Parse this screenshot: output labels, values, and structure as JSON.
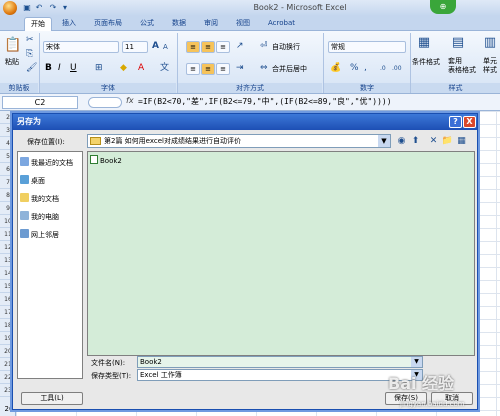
{
  "window": {
    "title": "Book2 - Microsoft Excel"
  },
  "ribbon": {
    "tabs": [
      "开始",
      "插入",
      "页面布局",
      "公式",
      "数据",
      "审阅",
      "视图",
      "Acrobat"
    ],
    "paste_label": "粘贴",
    "font_name": "宋体",
    "font_size": "11",
    "wrap_text": "自动换行",
    "merge_center": "合并后居中",
    "number_format": "常规",
    "cond_format": "条件格式",
    "table_format": "套用\n表格格式",
    "cell_styles": "单元\n样式",
    "groups": [
      "剪贴板",
      "字体",
      "对齐方式",
      "数字",
      "样式"
    ]
  },
  "formula_bar": {
    "name_box": "C2",
    "fx": "fx",
    "formula": "=IF(B2<70,\"差\",IF(B2<=79,\"中\",(IF(B2<=89,\"良\",\"优\"))))"
  },
  "sheet": {
    "rows": [
      "2",
      "3",
      "4",
      "5",
      "6",
      "7",
      "8",
      "9",
      "10",
      "11",
      "12",
      "13",
      "14",
      "15",
      "16",
      "17",
      "18",
      "19",
      "20",
      "21",
      "22",
      "23"
    ],
    "row26": "26",
    "row26_value": "80.00"
  },
  "dialog": {
    "title": "另存为",
    "save_in_label": "保存位置(I):",
    "save_in_value": "第2篇 如何用excel对成绩结果进行自动评价",
    "places": [
      "我最近的文档",
      "桌面",
      "我的文档",
      "我的电脑",
      "网上邻居"
    ],
    "file": "Book2",
    "filename_label": "文件名(N):",
    "filename_value": "Book2",
    "filetype_label": "保存类型(T):",
    "filetype_value": "Excel 工作簿",
    "tools": "工具(L)",
    "save": "保存(S)",
    "cancel": "取消",
    "help": "?",
    "close": "X"
  },
  "watermark": {
    "text": "Bai 经验",
    "url": "jingyan.baidu.com"
  },
  "colors": {
    "dialog_title": "#1d4fb4",
    "file_list_bg": "#d4ecd8",
    "ribbon_text": "#15428b"
  }
}
